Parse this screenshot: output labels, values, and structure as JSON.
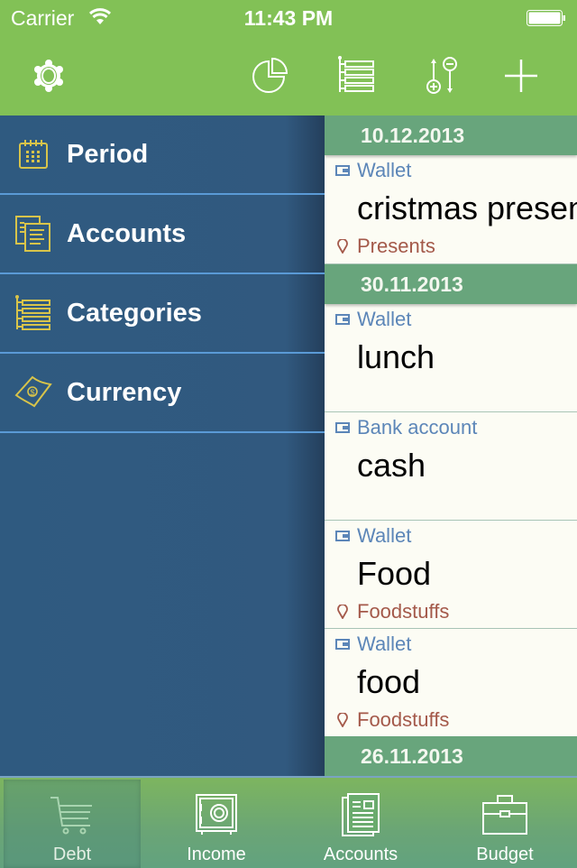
{
  "status_bar": {
    "carrier": "Carrier",
    "time": "11:43 PM"
  },
  "toolbar": {
    "icons": [
      "gear-icon",
      "pie-chart-icon",
      "category-tree-icon",
      "income-expense-toggle-icon",
      "plus-icon"
    ]
  },
  "sidebar": {
    "items": [
      {
        "label": "Period",
        "icon": "calendar-icon"
      },
      {
        "label": "Accounts",
        "icon": "documents-icon"
      },
      {
        "label": "Categories",
        "icon": "category-tree-icon"
      },
      {
        "label": "Currency",
        "icon": "banknote-icon"
      }
    ]
  },
  "transactions": {
    "groups": [
      {
        "date": "10.12.2013",
        "entries": [
          {
            "account": "Wallet",
            "title": "cristmas presents",
            "category": "Presents"
          }
        ]
      },
      {
        "date": "30.11.2013",
        "entries": [
          {
            "account": "Wallet",
            "title": "lunch",
            "category": ""
          },
          {
            "account": "Bank account",
            "title": "cash",
            "category": ""
          },
          {
            "account": "Wallet",
            "title": "Food",
            "category": "Foodstuffs"
          },
          {
            "account": "Wallet",
            "title": "food",
            "category": "Foodstuffs"
          }
        ]
      },
      {
        "date": "26.11.2013",
        "entries": []
      }
    ]
  },
  "tabbar": {
    "tabs": [
      {
        "label": "Debt",
        "icon": "shopping-cart-icon",
        "active": true
      },
      {
        "label": "Income",
        "icon": "safe-icon",
        "active": false
      },
      {
        "label": "Accounts",
        "icon": "newspaper-icon",
        "active": false
      },
      {
        "label": "Budget",
        "icon": "briefcase-icon",
        "active": false
      }
    ]
  },
  "colors": {
    "topbar": "#82c156",
    "sidebar": "#2f5a80",
    "sidebar_icon": "#d8c44a",
    "date_header": "#68a57c",
    "account_text": "#5c86b8",
    "category_text": "#a4594a"
  }
}
